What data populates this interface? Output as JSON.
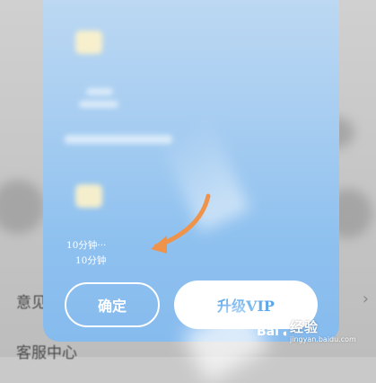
{
  "background": {
    "row1_label": "意见",
    "row2_label": "客服中心"
  },
  "dialog": {
    "timer_line1": "10分钟···",
    "timer_line2": "10分钟",
    "confirm_label": "确定",
    "vip_label": "升级VIP"
  },
  "watermark": {
    "logo_text": "Bai",
    "title": "经验",
    "url": "jingyan.baidu.com"
  },
  "colors": {
    "dialog_top": "#bcd8f2",
    "dialog_bottom": "#86bbee",
    "arrow": "#f0934a",
    "vip_text": "#5aa6ea"
  }
}
